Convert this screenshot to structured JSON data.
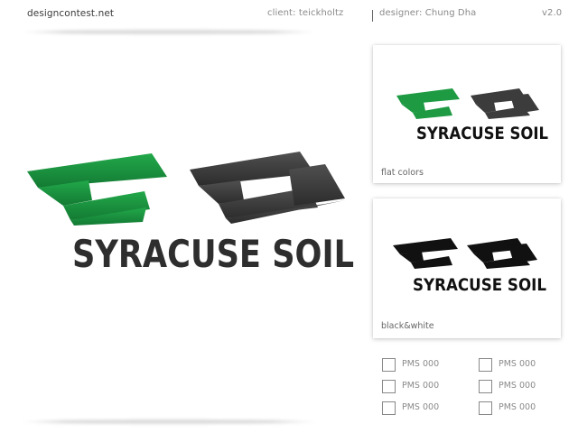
{
  "header": {
    "brand": "designcontest.net",
    "client": "client: teickholtz",
    "designer": "designer: Chung Dha",
    "version": "v2.0"
  },
  "logo": {
    "wordmark": "SYRACUSE SOIL",
    "green_color": "#1e9a43",
    "dark_color": "#3c3c3c",
    "black_color": "#111111"
  },
  "variants": [
    {
      "label": "flat colors"
    },
    {
      "label": "black&white"
    }
  ],
  "swatches": [
    {
      "label": "PMS 000"
    },
    {
      "label": "PMS 000"
    },
    {
      "label": "PMS 000"
    },
    {
      "label": "PMS 000"
    },
    {
      "label": "PMS 000"
    },
    {
      "label": "PMS 000"
    }
  ]
}
